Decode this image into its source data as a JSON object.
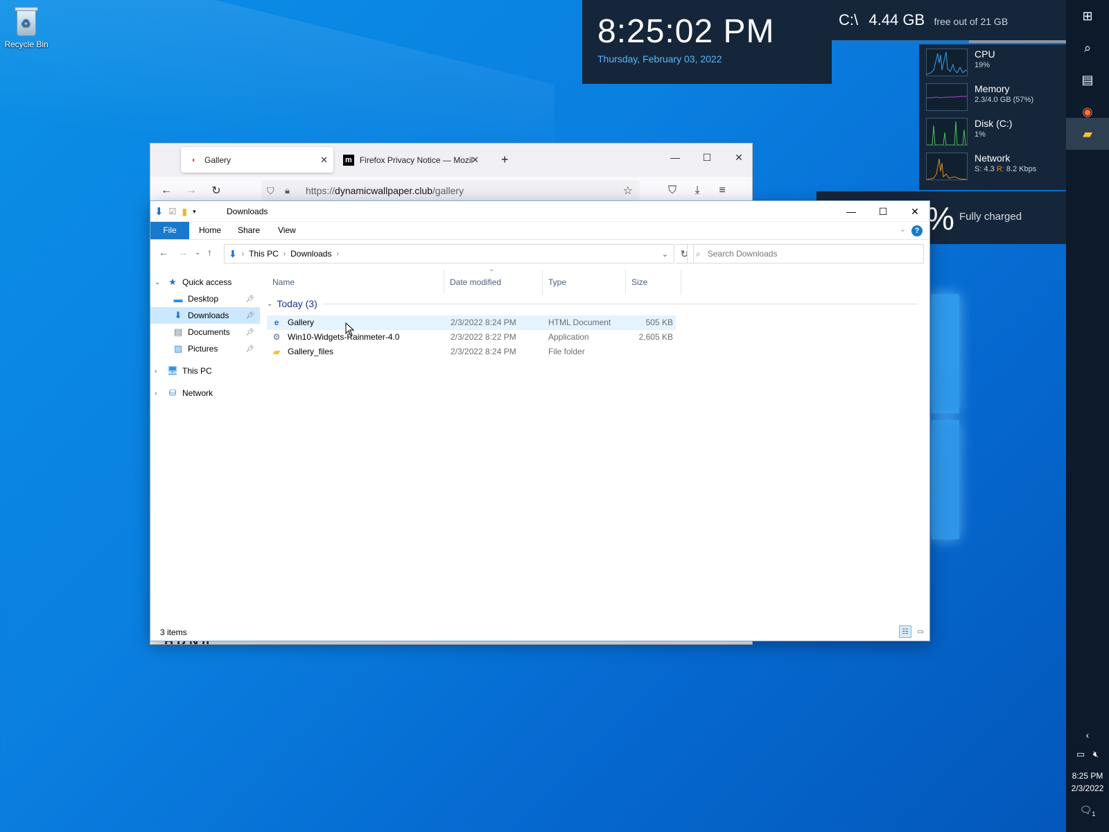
{
  "desktop": {
    "recycle_bin_label": "Recycle Bin"
  },
  "clock_widget": {
    "time": "8:25:02 PM",
    "date": "Thursday, February 03, 2022"
  },
  "disk_widget": {
    "drive": "C:\\",
    "free": "4.44 GB",
    "of_text": "free out of 21 GB"
  },
  "system_widget": {
    "cpu": {
      "label": "CPU",
      "value": "19%"
    },
    "memory": {
      "label": "Memory",
      "value": "2.3/4.0 GB (57%)"
    },
    "disk": {
      "label": "Disk (C:)",
      "value": "1%"
    },
    "network": {
      "label": "Network",
      "send_prefix": "S: 4.3",
      "recv_prefix": "R:",
      "recv_value": "8.2 Kbps"
    }
  },
  "battery_widget": {
    "percent_fragment": "%",
    "status": "Fully charged"
  },
  "taskbar": {
    "tray_time": "8:25 PM",
    "tray_date": "2/3/2022",
    "notification_count": "1",
    "icons": [
      "windows-start-icon",
      "search-icon",
      "task-view-icon",
      "firefox-icon",
      "file-explorer-icon"
    ]
  },
  "firefox": {
    "tabs": [
      {
        "title": "Gallery",
        "active": true
      },
      {
        "title": "Firefox Privacy Notice — Mozil",
        "active": false
      }
    ],
    "url_prefix": "https://",
    "url_domain": "dynamicwallpaper.club",
    "url_path": "/gallery",
    "peek_text": "B  D  N  h"
  },
  "explorer": {
    "title": "Downloads",
    "ribbon_tabs": [
      "File",
      "Home",
      "Share",
      "View"
    ],
    "breadcrumb": [
      "This PC",
      "Downloads"
    ],
    "search_placeholder": "Search Downloads",
    "nav": {
      "quick_access": "Quick access",
      "desktop": "Desktop",
      "downloads": "Downloads",
      "documents": "Documents",
      "pictures": "Pictures",
      "this_pc": "This PC",
      "network": "Network"
    },
    "columns": {
      "name": "Name",
      "date": "Date modified",
      "type": "Type",
      "size": "Size"
    },
    "group_label": "Today (3)",
    "files": [
      {
        "name": "Gallery",
        "date": "2/3/2022 8:24 PM",
        "type": "HTML Document",
        "size": "505 KB"
      },
      {
        "name": "Win10-Widgets-Rainmeter-4.0",
        "date": "2/3/2022 8:22 PM",
        "type": "Application",
        "size": "2,605 KB"
      },
      {
        "name": "Gallery_files",
        "date": "2/3/2022 8:24 PM",
        "type": "File folder",
        "size": ""
      }
    ],
    "status_count": "3 items"
  },
  "colors": {
    "accent": "#1979ca",
    "widget_bg": "#16263a",
    "selection": "#cce8ff"
  }
}
